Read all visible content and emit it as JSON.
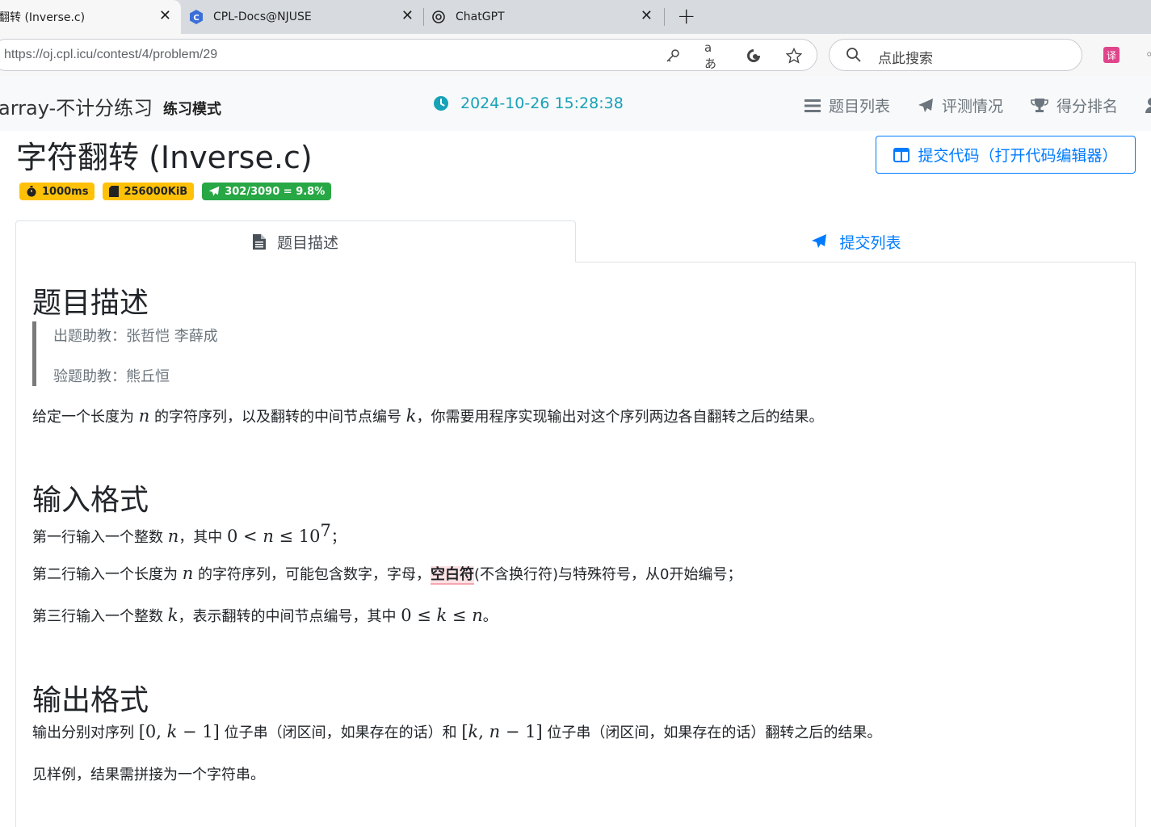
{
  "browser": {
    "tabs": [
      {
        "label": "翻转 (Inverse.c)",
        "active": true
      },
      {
        "label": "CPL-Docs@NJUSE",
        "active": false
      },
      {
        "label": "ChatGPT",
        "active": false
      }
    ],
    "close_glyph": "✕",
    "new_tab_glyph": "+",
    "url": "https://oj.cpl.icu/contest/4/problem/29",
    "search_placeholder": "点此搜索",
    "ext_label": "译"
  },
  "navbar": {
    "contest_title": "array-不计分练习",
    "mode": "练习模式",
    "clock": "2024-10-26 15:28:38",
    "links": [
      "题目列表",
      "评测情况",
      "得分排名"
    ]
  },
  "problem": {
    "title": "字符翻转 (Inverse.c)",
    "submit_button": "提交代码（打开代码编辑器）",
    "badges": {
      "time": "1000ms",
      "memory": "256000KiB",
      "ratio": "302/3090 = 9.8%"
    },
    "tabs": {
      "description": "题目描述",
      "submissions": "提交列表"
    }
  },
  "content": {
    "desc_heading": "题目描述",
    "setter": "出题助教：张哲恺 李薛成",
    "tester": "验题助教：熊丘恒",
    "desc": {
      "p1": "给定一个长度为 ",
      "v1": "n",
      "p2": " 的字符序列，以及翻转的中间节点编号 ",
      "v2": "k",
      "p3": "，你需要用程序实现输出对这个序列两边各自翻转之后的结果。"
    },
    "input_heading": "输入格式",
    "in1": {
      "p1": "第一行输入一个整数 ",
      "v1": "n",
      "p2": "，其中 ",
      "z": "0 < ",
      "v2": "n",
      "le": " ≤ 10",
      "exp": "7",
      "p3": "；"
    },
    "in2": {
      "p1": "第二行输入一个长度为 ",
      "v1": "n",
      "p2": " 的字符序列，可能包含数字，字母，",
      "hl": "空白符",
      "p3": "(不含换行符)与特殊符号，从0开始编号；"
    },
    "in3": {
      "p1": "第三行输入一个整数 ",
      "v1": "k",
      "p2": "，表示翻转的中间节点编号，其中 ",
      "z": "0 ≤ ",
      "v2": "k",
      "le": " ≤ ",
      "v3": "n",
      "p3": "。"
    },
    "output_heading": "输出格式",
    "out1": {
      "p1": "输出分别对序列 ",
      "r1": "[0, ",
      "v1": "k",
      "r2": " − 1]",
      "p2": " 位子串（闭区间，如果存在的话）和 ",
      "r3": "[",
      "v2": "k",
      "r4": ", ",
      "v3": "n",
      "r5": " − 1]",
      "p3": " 位子串（闭区间，如果存在的话）翻转之后的结果。"
    },
    "out2": "见样例，结果需拼接为一个字符串。"
  }
}
